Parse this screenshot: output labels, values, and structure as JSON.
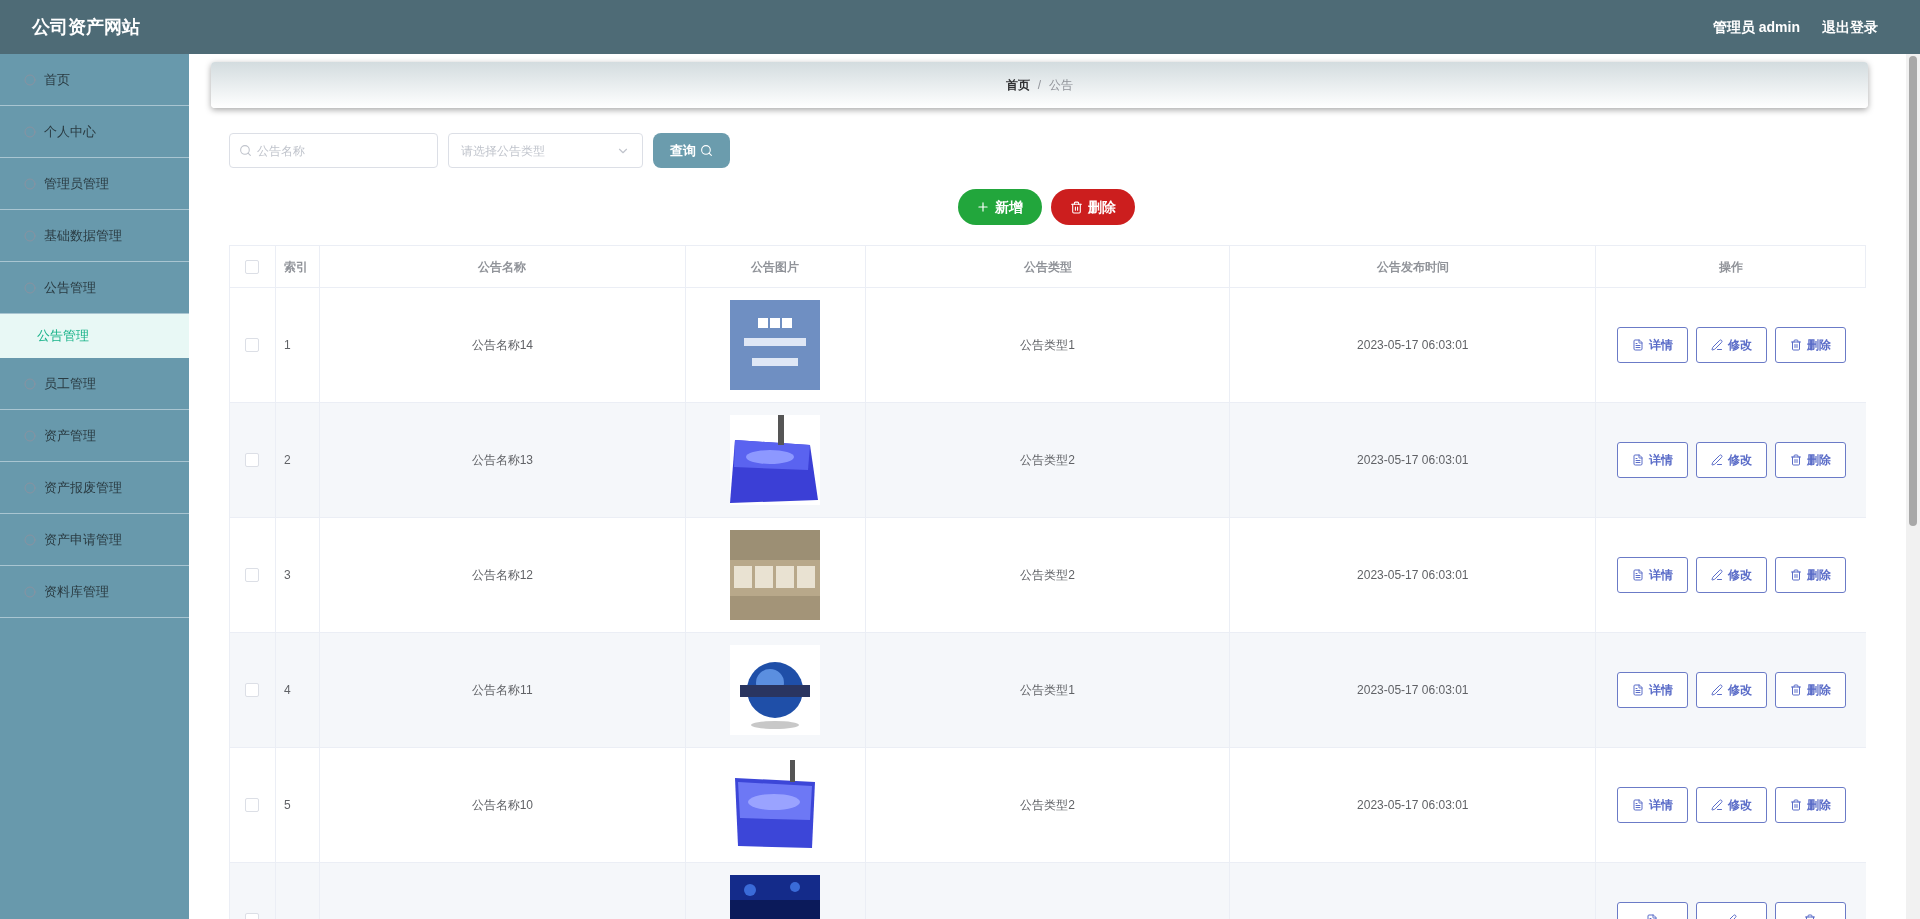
{
  "header": {
    "title": "公司资产网站",
    "user": "管理员 admin",
    "logout": "退出登录"
  },
  "sidebar": {
    "items": [
      {
        "label": "首页",
        "selected": false
      },
      {
        "label": "个人中心",
        "selected": false
      },
      {
        "label": "管理员管理",
        "selected": false
      },
      {
        "label": "基础数据管理",
        "selected": false
      },
      {
        "label": "公告管理",
        "selected": false,
        "children": [
          {
            "label": "公告管理",
            "selected": true
          }
        ]
      },
      {
        "label": "员工管理",
        "selected": false
      },
      {
        "label": "资产管理",
        "selected": false
      },
      {
        "label": "资产报废管理",
        "selected": false
      },
      {
        "label": "资产申请管理",
        "selected": false
      },
      {
        "label": "资料库管理",
        "selected": false
      }
    ]
  },
  "breadcrumb": [
    "首页",
    "/",
    "公告"
  ],
  "search": {
    "placeholder": "公告名称",
    "type_placeholder": "请选择公告类型",
    "query": "查询"
  },
  "actions": {
    "add": "新增",
    "delete": "删除"
  },
  "table": {
    "all_checked": false,
    "columns": [
      "索引",
      "公告名称",
      "公告图片",
      "公告类型",
      "公告发布时间",
      "操作"
    ],
    "rows": [
      {
        "index": "1",
        "name": "公告名称14",
        "type": "公告类型1",
        "time": "2023-05-17 06:03:01",
        "selected": false,
        "actions": [
          "详情",
          "修改",
          "删除"
        ]
      },
      {
        "index": "2",
        "name": "公告名称13",
        "type": "公告类型2",
        "time": "2023-05-17 06:03:01",
        "selected": false,
        "actions": [
          "详情",
          "修改",
          "删除"
        ]
      },
      {
        "index": "3",
        "name": "公告名称12",
        "type": "公告类型2",
        "time": "2023-05-17 06:03:01",
        "selected": false,
        "actions": [
          "详情",
          "修改",
          "删除"
        ]
      },
      {
        "index": "4",
        "name": "公告名称11",
        "type": "公告类型1",
        "time": "2023-05-17 06:03:01",
        "selected": false,
        "actions": [
          "详情",
          "修改",
          "删除"
        ]
      },
      {
        "index": "5",
        "name": "公告名称10",
        "type": "公告类型2",
        "time": "2023-05-17 06:03:01",
        "selected": false,
        "actions": [
          "详情",
          "修改",
          "删除"
        ]
      },
      {
        "selected": false
      }
    ]
  }
}
